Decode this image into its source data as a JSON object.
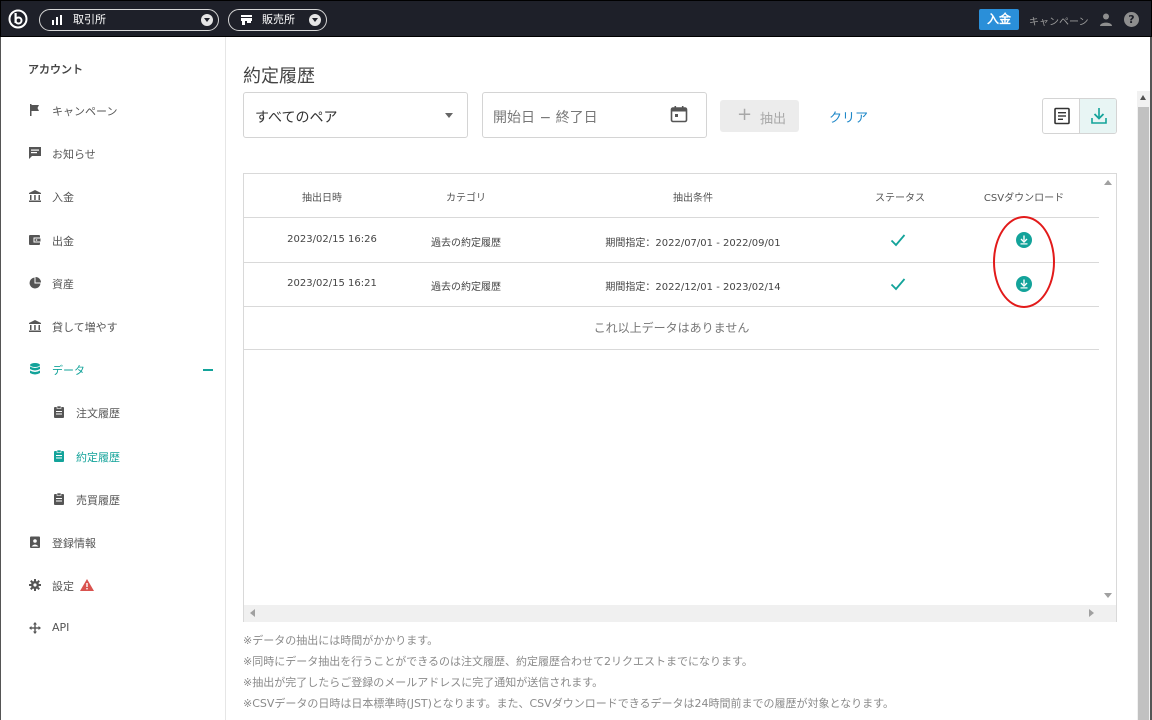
{
  "topbar": {
    "exchange_label": "取引所",
    "sales_label": "販売所",
    "deposit_label": "入金",
    "campaign_label": "キャンペーン"
  },
  "sidebar": {
    "heading": "アカウント",
    "items": [
      {
        "label": "キャンペーン",
        "icon": "flag-icon"
      },
      {
        "label": "お知らせ",
        "icon": "message-icon"
      },
      {
        "label": "入金",
        "icon": "bank-icon"
      },
      {
        "label": "出金",
        "icon": "wallet-icon"
      },
      {
        "label": "資産",
        "icon": "pie-chart-icon"
      },
      {
        "label": "貸して増やす",
        "icon": "bank-icon"
      },
      {
        "label": "データ",
        "icon": "database-icon"
      },
      {
        "label": "注文履歴",
        "icon": "clipboard-icon"
      },
      {
        "label": "約定履歴",
        "icon": "clipboard-icon"
      },
      {
        "label": "売買履歴",
        "icon": "clipboard-icon"
      },
      {
        "label": "登録情報",
        "icon": "id-badge-icon"
      },
      {
        "label": "設定",
        "icon": "gear-icon"
      },
      {
        "label": "API",
        "icon": "move-icon"
      }
    ],
    "active_color": "#13a39a"
  },
  "main": {
    "title": "約定履歴",
    "pair_select_value": "すべてのペア",
    "date_placeholder": "開始日 − 終了日",
    "extract_label": "抽出",
    "clear_label": "クリア"
  },
  "table": {
    "headers": [
      "抽出日時",
      "カテゴリ",
      "抽出条件",
      "ステータス",
      "CSVダウンロード"
    ],
    "rows": [
      {
        "datetime": "2023/02/15 16:26",
        "category": "過去の約定履歴",
        "condition": "期間指定：2022/07/01 - 2022/09/01",
        "status": "completed"
      },
      {
        "datetime": "2023/02/15 16:21",
        "category": "過去の約定履歴",
        "condition": "期間指定：2022/12/01 - 2023/02/14",
        "status": "completed"
      }
    ],
    "empty_message": "これ以上データはありません"
  },
  "notes": [
    "※データの抽出には時間がかかります。",
    "※同時にデータ抽出を行うことができるのは注文履歴、約定履歴合わせて2リクエストまでになります。",
    "※抽出が完了したらご登録のメールアドレスに完了通知が送信されます。",
    "※CSVデータの日時は日本標準時(JST)となります。また、CSVダウンロードできるデータは24時間前までの履歴が対象となります。"
  ],
  "colors": {
    "accent": "#13a39a",
    "deposit": "#2a8fd9",
    "link": "#1f88c8",
    "highlight": "#e21a1a"
  }
}
